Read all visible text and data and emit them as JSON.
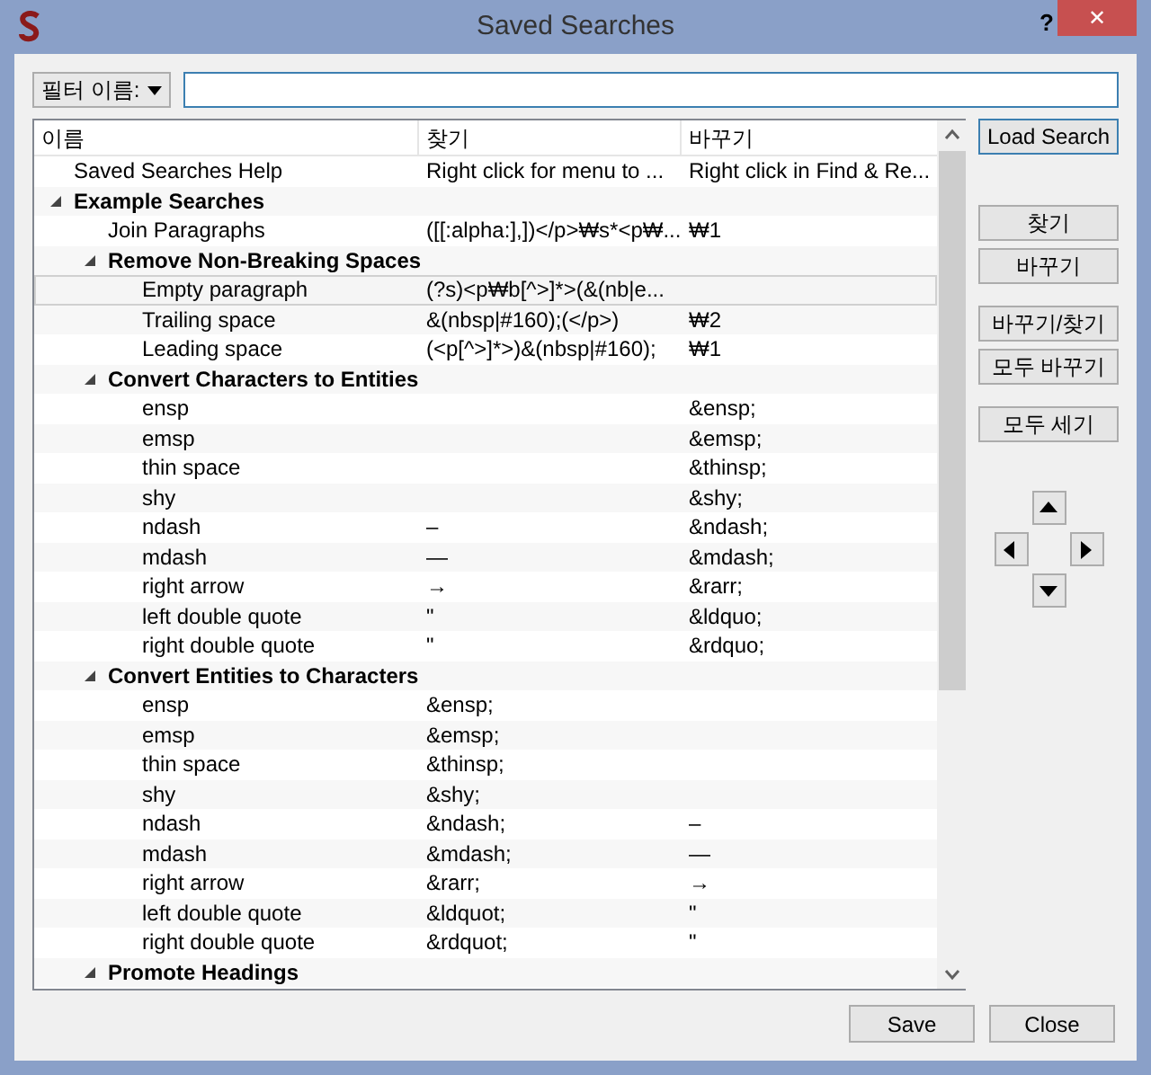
{
  "window": {
    "title": "Saved Searches",
    "help": "?",
    "close": "✕"
  },
  "filter": {
    "label": "필터 이름:"
  },
  "tree": {
    "columns": [
      "이름",
      "찾기",
      "바꾸기"
    ],
    "rows": [
      {
        "name": "Saved Searches Help",
        "find": "Right click for menu to ...",
        "replace": "Right click in Find & Re...",
        "selected": false
      },
      {
        "name": "Example Searches",
        "expanded": true,
        "children": [
          {
            "name": "Join Paragraphs",
            "find": "([[:alpha:],])</p>₩s*<p₩...",
            "replace": "₩1",
            "selected": false
          },
          {
            "name": "Remove Non-Breaking Spaces",
            "expanded": true,
            "children": [
              {
                "name": "Empty paragraph",
                "find": "(?s)<p₩b[^>]*>(&(nb|e...",
                "selected": true
              },
              {
                "name": "Trailing space",
                "find": "&(nbsp|#160);(</p>)",
                "replace": "₩2",
                "selected": false
              },
              {
                "name": "Leading space",
                "find": "(<p[^>]*>)&(nbsp|#160);",
                "replace": "₩1",
                "selected": false
              }
            ]
          },
          {
            "name": "Convert Characters to Entities",
            "expanded": true,
            "children": [
              {
                "name": "ensp",
                "replace": "&ensp;",
                "selected": false
              },
              {
                "name": "emsp",
                "replace": "&emsp;",
                "selected": false
              },
              {
                "name": "thin space",
                "replace": "&thinsp;",
                "selected": false
              },
              {
                "name": "shy",
                "replace": "&shy;",
                "selected": false
              },
              {
                "name": "ndash",
                "find": "–",
                "replace": "&ndash;",
                "selected": false
              },
              {
                "name": "mdash",
                "find": "—",
                "replace": "&mdash;",
                "selected": false
              },
              {
                "name": "right arrow",
                "find": "→",
                "replace": "&rarr;",
                "selected": false
              },
              {
                "name": "left double quote",
                "find": "\"",
                "replace": "&ldquo;",
                "selected": false
              },
              {
                "name": "right double quote",
                "find": "\"",
                "replace": "&rdquo;",
                "selected": false
              }
            ]
          },
          {
            "name": "Convert Entities to Characters",
            "expanded": true,
            "children": [
              {
                "name": "ensp",
                "find": "&ensp;",
                "selected": false
              },
              {
                "name": "emsp",
                "find": "&emsp;",
                "selected": false
              },
              {
                "name": "thin space",
                "find": "&thinsp;",
                "selected": false
              },
              {
                "name": "shy",
                "find": "&shy;",
                "selected": false
              },
              {
                "name": "ndash",
                "find": "&ndash;",
                "replace": "–",
                "selected": false
              },
              {
                "name": "mdash",
                "find": "&mdash;",
                "replace": "—",
                "selected": false
              },
              {
                "name": "right arrow",
                "find": "&rarr;",
                "replace": "→",
                "selected": false
              },
              {
                "name": "left double quote",
                "find": "&ldquot;",
                "replace": "\"",
                "selected": false
              },
              {
                "name": "right double quote",
                "find": "&rdquot;",
                "replace": "\"",
                "selected": false
              }
            ]
          },
          {
            "name": "Promote Headings",
            "expanded": true
          }
        ]
      }
    ]
  },
  "side_buttons": [
    {
      "label": "Load Search",
      "kind": "default"
    },
    {
      "label": "찾기",
      "kind": "normal"
    },
    {
      "label": "바꾸기",
      "kind": "normal"
    },
    {
      "label": "바꾸기/찾기",
      "kind": "normal"
    },
    {
      "label": "모두 바꾸기",
      "kind": "normal"
    },
    {
      "label": "모두 세기",
      "kind": "normal"
    }
  ],
  "footer_buttons": [
    "Save",
    "Close"
  ]
}
